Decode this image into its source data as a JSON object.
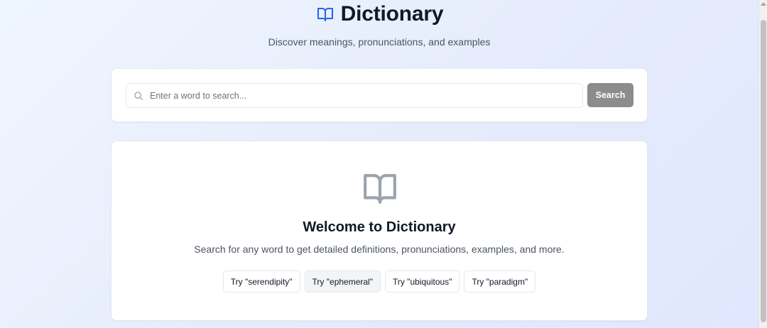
{
  "header": {
    "title": "Dictionary",
    "subtitle": "Discover meanings, pronunciations, and examples",
    "logo_icon": "book-open-icon",
    "accent_color": "#2563eb"
  },
  "search": {
    "placeholder": "Enter a word to search...",
    "value": "",
    "button_label": "Search",
    "button_color": "#8c8c8c",
    "icon": "search-icon"
  },
  "welcome": {
    "icon": "book-open-icon",
    "title": "Welcome to Dictionary",
    "description": "Search for any word to get detailed definitions, pronunciations, examples, and more.",
    "suggestions": [
      {
        "label": "Try \"serendipity\""
      },
      {
        "label": "Try \"ephemeral\""
      },
      {
        "label": "Try \"ubiquitous\""
      },
      {
        "label": "Try \"paradigm\""
      }
    ]
  }
}
